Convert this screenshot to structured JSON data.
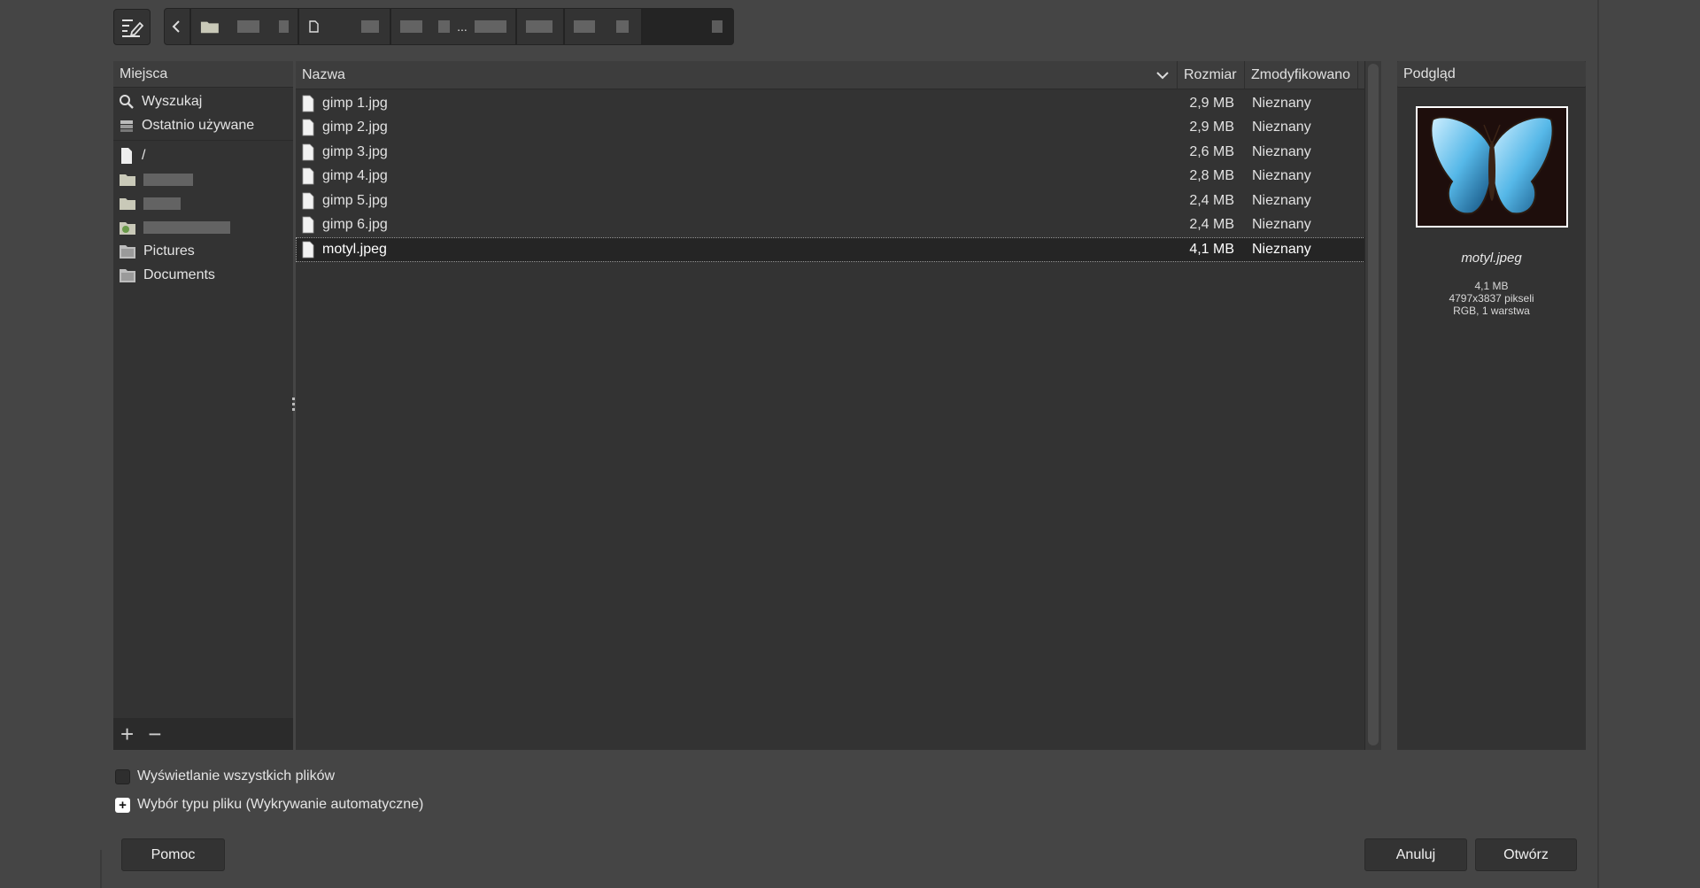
{
  "toolbar": {
    "edit_icon": "edit-location-icon",
    "back_icon": "chevron-left-icon",
    "crumbs": [
      "",
      "",
      "...",
      "",
      "",
      ""
    ]
  },
  "places": {
    "header": "Miejsca",
    "items": [
      {
        "label": "Wyszukaj",
        "icon": "search-icon"
      },
      {
        "label": "Ostatnio używane",
        "icon": "recent-icon"
      },
      {
        "label": "/",
        "icon": "file-system-icon"
      },
      {
        "label": "",
        "icon": "folder-icon"
      },
      {
        "label": "",
        "icon": "folder-icon"
      },
      {
        "label": "",
        "icon": "home-icon"
      },
      {
        "label": "Pictures",
        "icon": "folder-icon"
      },
      {
        "label": "Documents",
        "icon": "folder-icon"
      }
    ],
    "add": "+",
    "remove": "−"
  },
  "files": {
    "columns": {
      "name": "Nazwa",
      "size": "Rozmiar",
      "modified": "Zmodyfikowano"
    },
    "rows": [
      {
        "name": "gimp 1.jpg",
        "size": "2,9 MB",
        "modified": "Nieznany"
      },
      {
        "name": "gimp 2.jpg",
        "size": "2,9 MB",
        "modified": "Nieznany"
      },
      {
        "name": "gimp 3.jpg",
        "size": "2,6 MB",
        "modified": "Nieznany"
      },
      {
        "name": "gimp 4.jpg",
        "size": "2,8 MB",
        "modified": "Nieznany"
      },
      {
        "name": "gimp 5.jpg",
        "size": "2,4 MB",
        "modified": "Nieznany"
      },
      {
        "name": "gimp 6.jpg",
        "size": "2,4 MB",
        "modified": "Nieznany"
      },
      {
        "name": "motyl.jpeg",
        "size": "4,1 MB",
        "modified": "Nieznany",
        "selected": true
      }
    ]
  },
  "preview": {
    "header": "Podgląd",
    "filename": "motyl.jpeg",
    "info_size": "4,1 MB",
    "info_dims": "4797x3837 pikseli",
    "info_mode": "RGB, 1 warstwa"
  },
  "options": {
    "show_all_label": "Wyświetlanie wszystkich plików",
    "file_type_label": "Wybór typu pliku (Wykrywanie automatyczne)"
  },
  "buttons": {
    "help": "Pomoc",
    "cancel": "Anuluj",
    "open": "Otwórz"
  }
}
